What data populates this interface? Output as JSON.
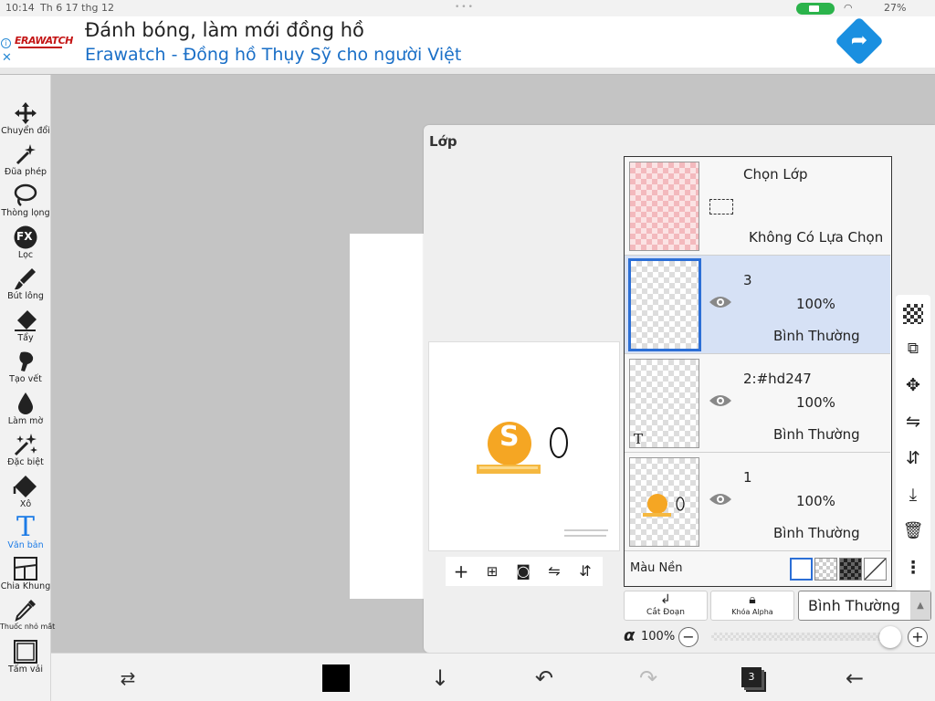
{
  "status_bar": {
    "time": "10:14",
    "date": "Th 6 17 thg 12",
    "battery": "27%"
  },
  "ad": {
    "brand": "ERAWATCH",
    "headline": "Đánh bóng, làm mới đồng hồ",
    "subline": "Erawatch - Đồng hồ Thụy Sỹ cho người Việt",
    "info_glyph": "i",
    "close_glyph": "✕"
  },
  "tools": [
    {
      "id": "transform",
      "label": "Chuyển đổi",
      "icon": "move-icon"
    },
    {
      "id": "magic",
      "label": "Đũa phép",
      "icon": "magic-wand-icon"
    },
    {
      "id": "lasso",
      "label": "Thòng lọng",
      "icon": "lasso-icon"
    },
    {
      "id": "filter",
      "label": "Lọc",
      "icon": "fx-icon",
      "glyph": "FX"
    },
    {
      "id": "brush",
      "label": "Bút lông",
      "icon": "brush-icon"
    },
    {
      "id": "eraser",
      "label": "Tẩy",
      "icon": "eraser-icon"
    },
    {
      "id": "smudge",
      "label": "Tạo vết",
      "icon": "smudge-icon"
    },
    {
      "id": "blur",
      "label": "Làm mờ",
      "icon": "blur-drop-icon"
    },
    {
      "id": "special",
      "label": "Đặc biệt",
      "icon": "sparkle-wand-icon"
    },
    {
      "id": "bucket",
      "label": "Xô",
      "icon": "bucket-icon"
    },
    {
      "id": "text",
      "label": "Văn bản",
      "icon": "text-icon",
      "glyph": "T",
      "active": true
    },
    {
      "id": "frame",
      "label": "Chia Khung",
      "icon": "frame-divider-icon"
    },
    {
      "id": "eyedrop",
      "label": "Thuốc nhỏ mắt",
      "icon": "eyedropper-icon"
    },
    {
      "id": "canvas",
      "label": "Tấm vải",
      "icon": "canvas-icon"
    }
  ],
  "panel": {
    "title": "Lớp",
    "selection_row": {
      "name": "Chọn Lớp",
      "status": "Không Có Lựa Chọn"
    },
    "layers": [
      {
        "name": "3",
        "opacity": "100%",
        "mode": "Bình Thường",
        "selected": true,
        "thumb_mark": ""
      },
      {
        "name": "2:#hd247",
        "opacity": "100%",
        "mode": "Bình Thường",
        "selected": false,
        "thumb_mark": "T"
      },
      {
        "name": "1",
        "opacity": "100%",
        "mode": "Bình Thường",
        "selected": false,
        "thumb_mark": ""
      }
    ],
    "background_label": "Màu Nền",
    "clip_label": "Cắt Đoạn",
    "alpha_lock_label": "Khóa Alpha",
    "blend_mode": "Bình Thường",
    "alpha_symbol": "α",
    "alpha_value": "100%",
    "alpha_fraction": 1.0,
    "preview_coin_glyph": "S"
  },
  "bottom_bar": {
    "layer_count": "3"
  },
  "colors": {
    "accent": "#1c7be6",
    "selected_row": "#d6e1f5",
    "coin": "#f5a623",
    "ad_blue": "#1a6fc7",
    "brand_red": "#c41515",
    "primary_color": "#000000"
  }
}
